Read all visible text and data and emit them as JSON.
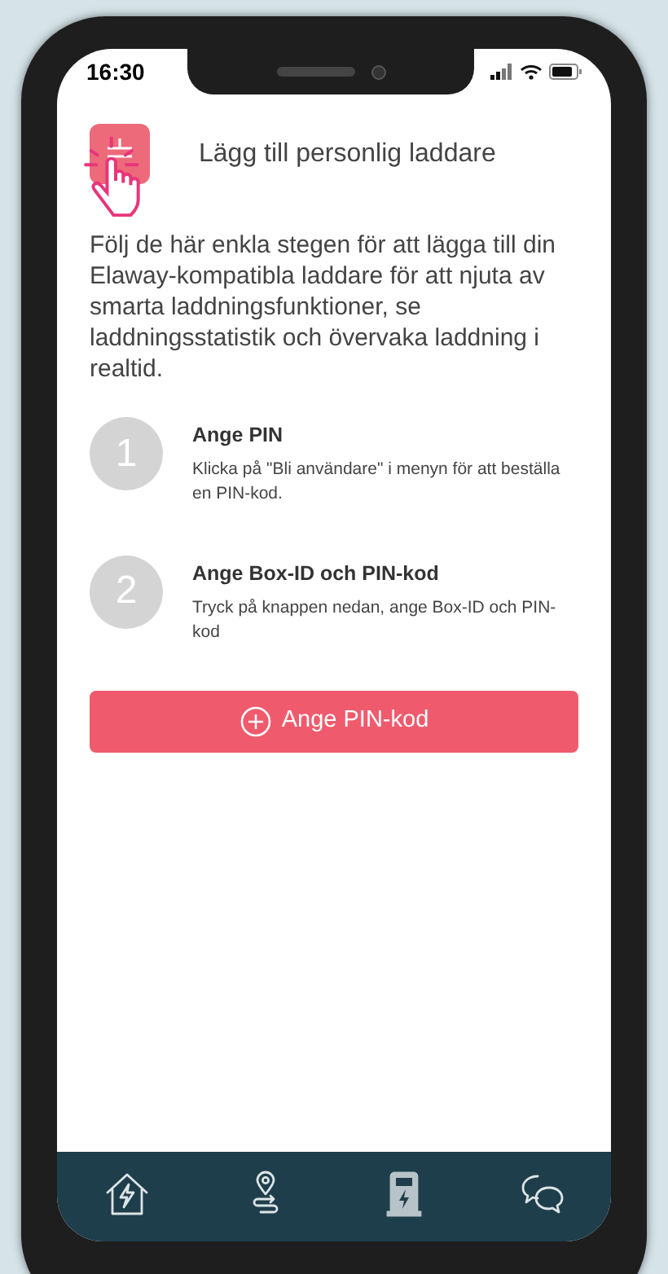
{
  "status_bar": {
    "time": "16:30"
  },
  "header": {
    "title": "Lägg till personlig laddare"
  },
  "intro": "Följ de här enkla stegen för att lägga till din Elaway-kompatibla laddare för att njuta av smarta laddningsfunktioner, se laddningsstatistik och övervaka laddning i realtid.",
  "steps": [
    {
      "number": "1",
      "title": "Ange PIN",
      "text": "Klicka på \"Bli användare\" i menyn för att beställa en PIN-kod."
    },
    {
      "number": "2",
      "title": "Ange Box-ID och PIN-kod",
      "text": "Tryck på knappen nedan, ange Box-ID och PIN-kod"
    }
  ],
  "action_button": {
    "label": "Ange PIN-kod"
  },
  "nav": [
    {
      "kind": "home",
      "selected": false
    },
    {
      "kind": "route",
      "selected": false
    },
    {
      "kind": "charger",
      "selected": true
    },
    {
      "kind": "chat",
      "selected": false
    }
  ]
}
